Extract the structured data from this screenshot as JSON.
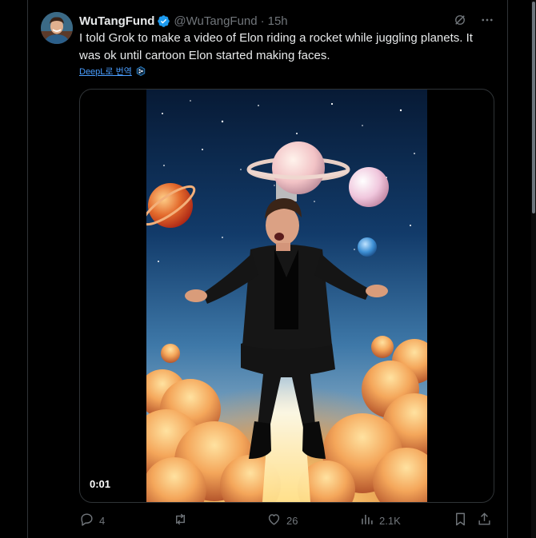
{
  "tweet": {
    "display_name": "WuTangFund",
    "handle": "@WuTangFund",
    "separator": "·",
    "time": "15h",
    "text": "I told Grok to make a video of Elon riding a rocket while juggling planets.  It was ok until cartoon Elon started making faces.",
    "translate_label": "DeepL로 번역",
    "video": {
      "timestamp": "0:01"
    },
    "actions": {
      "replies": "4",
      "retweets": "",
      "likes": "26",
      "views": "2.1K"
    }
  },
  "icons": {
    "verified": "verified-badge-icon",
    "grok": "grok-icon",
    "more": "more-icon",
    "translate": "deepl-icon",
    "reply": "reply-icon",
    "retweet": "retweet-icon",
    "like": "like-icon",
    "views": "views-icon",
    "bookmark": "bookmark-icon",
    "share": "share-icon"
  },
  "colors": {
    "background": "#000000",
    "text": "#e7e9ea",
    "muted": "#71767b",
    "verified": "#1d9bf0",
    "link": "#4a9eff",
    "border": "#2f3336"
  }
}
